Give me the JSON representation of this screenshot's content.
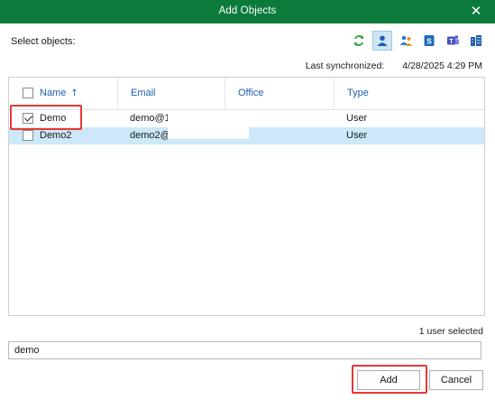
{
  "window": {
    "title": "Add Objects",
    "close_glyph": "✕"
  },
  "header": {
    "select_label": "Select objects:",
    "toolbar_icons": [
      "refresh-icon",
      "user-icon",
      "group-icon",
      "sharepoint-icon",
      "teams-icon",
      "organization-icon"
    ],
    "active_icon": "user-icon"
  },
  "sync": {
    "label": "Last synchronized:",
    "value": "4/28/2025 4:29 PM"
  },
  "table": {
    "columns": [
      {
        "label": "Name",
        "sort_glyph": "↑"
      },
      {
        "label": "Email"
      },
      {
        "label": "Office"
      },
      {
        "label": "Type"
      }
    ],
    "rows": [
      {
        "name": "Demo",
        "email": "demo@1",
        "office": "",
        "type": "User",
        "checked": true,
        "selected": false
      },
      {
        "name": "Demo2",
        "email": "demo2@",
        "office": "",
        "type": "User",
        "checked": false,
        "selected": true
      }
    ]
  },
  "footer": {
    "selection_count": "1 user selected",
    "search_value": "demo",
    "add_label": "Add",
    "cancel_label": "Cancel"
  },
  "colors": {
    "titlebar": "#0b7a3a",
    "link_blue": "#1f5fae",
    "row_selected": "#cde8f8",
    "highlight_red": "#e53935"
  }
}
